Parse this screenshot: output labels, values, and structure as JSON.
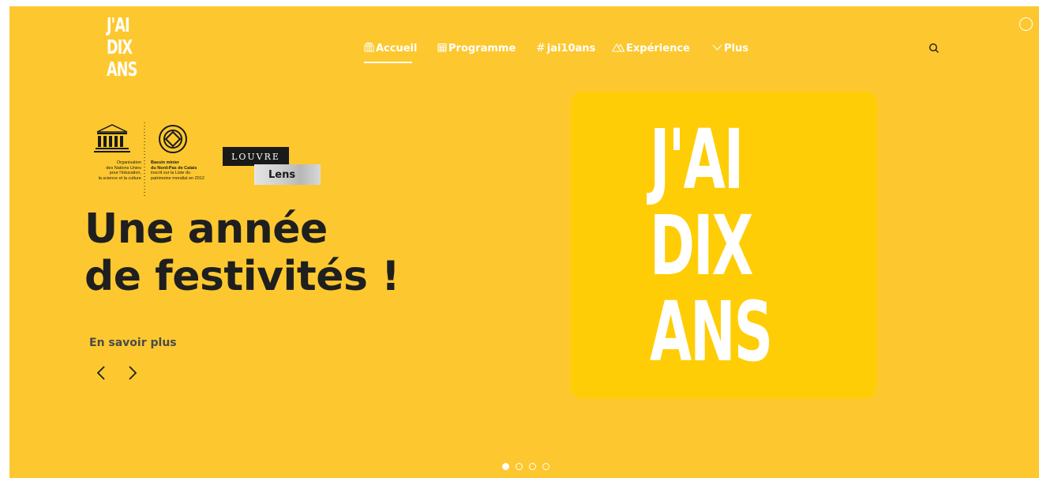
{
  "brand": {
    "logo_lines": [
      "J'AI",
      "DIX",
      "ANS"
    ]
  },
  "nav": {
    "items": [
      {
        "label": "Accueil",
        "icon": "building-icon",
        "glyph": "嵐"
      },
      {
        "label": "Programme",
        "icon": "calendar-icon",
        "glyph": "▦"
      },
      {
        "label": "jai10ans",
        "icon": "hashtag-icon",
        "glyph": "#"
      },
      {
        "label": "Expérience",
        "icon": "mountain-icon",
        "glyph": "△"
      },
      {
        "label": "Plus",
        "icon": "chevron-down-icon",
        "glyph": "∨"
      }
    ],
    "active_index": 0
  },
  "partners": {
    "unesco_left": [
      "Organisation",
      "des Nations Unies",
      "pour l'éducation,",
      "la science et la culture"
    ],
    "unesco_right_bold": [
      "Bassin minier",
      "du Nord-Pas de Calais"
    ],
    "unesco_right": [
      "inscrit sur la Liste du",
      "patrimoine mondial en 2012"
    ],
    "unesco_wordmark": "UNESCO",
    "louvre_top": "LOUVRE",
    "louvre_bottom": "Lens"
  },
  "hero": {
    "headline_line1": "Une année",
    "headline_line2": "de festivités !",
    "more_link": "En savoir plus",
    "big_logo_lines": [
      "J'AI",
      "DIX",
      "ANS"
    ]
  },
  "carousel": {
    "slide_count": 4,
    "active_slide": 1
  },
  "colors": {
    "background": "#fdc82f",
    "square": "#ffcd05",
    "text_dark": "#1f1f1f",
    "white": "#ffffff"
  }
}
